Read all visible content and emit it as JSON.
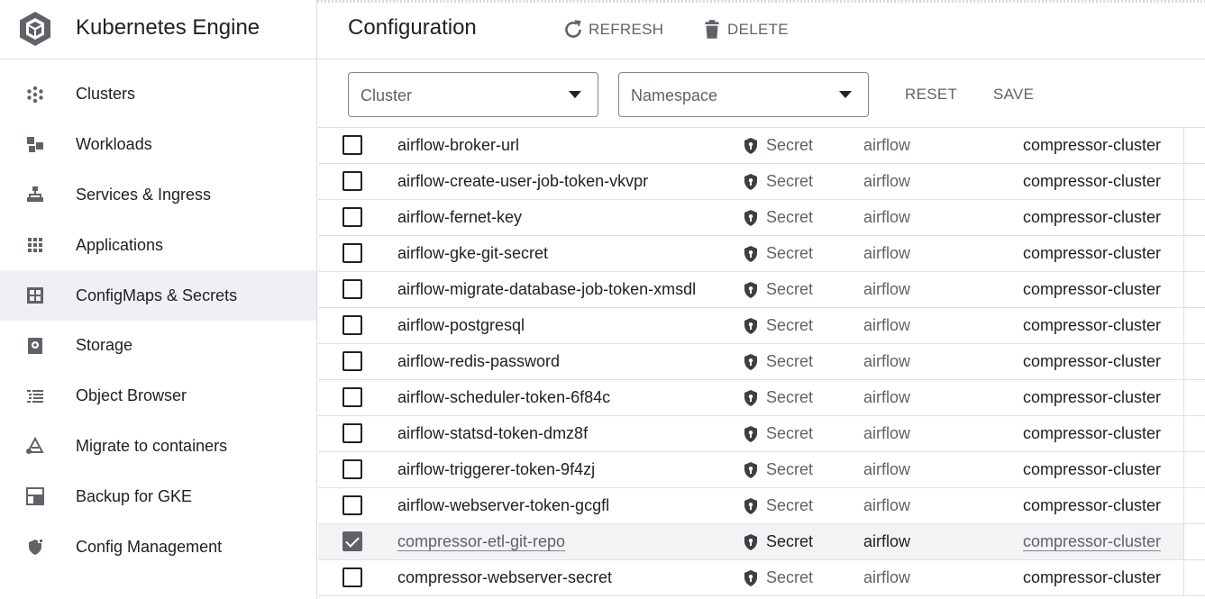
{
  "app": {
    "title": "Kubernetes Engine",
    "logo_icon": "kubernetes-engine-icon"
  },
  "sidebar": {
    "items": [
      {
        "label": "Clusters",
        "icon": "clusters-icon",
        "active": false
      },
      {
        "label": "Workloads",
        "icon": "workloads-icon",
        "active": false
      },
      {
        "label": "Services & Ingress",
        "icon": "services-icon",
        "active": false
      },
      {
        "label": "Applications",
        "icon": "applications-icon",
        "active": false
      },
      {
        "label": "ConfigMaps & Secrets",
        "icon": "configmaps-icon",
        "active": true
      },
      {
        "label": "Storage",
        "icon": "storage-icon",
        "active": false
      },
      {
        "label": "Object Browser",
        "icon": "object-browser-icon",
        "active": false
      },
      {
        "label": "Migrate to containers",
        "icon": "migrate-icon",
        "active": false
      },
      {
        "label": "Backup for GKE",
        "icon": "backup-icon",
        "active": false
      },
      {
        "label": "Config Management",
        "icon": "config-management-icon",
        "active": false
      }
    ]
  },
  "header": {
    "title": "Configuration",
    "refresh_label": "REFRESH",
    "delete_label": "DELETE"
  },
  "filters": {
    "cluster_placeholder": "Cluster",
    "namespace_placeholder": "Namespace",
    "reset_label": "RESET",
    "save_label": "SAVE"
  },
  "table": {
    "rows": [
      {
        "name": "airflow-broker-url",
        "type": "Secret",
        "namespace": "airflow",
        "cluster": "compressor-cluster",
        "checked": false
      },
      {
        "name": "airflow-create-user-job-token-vkvpr",
        "type": "Secret",
        "namespace": "airflow",
        "cluster": "compressor-cluster",
        "checked": false
      },
      {
        "name": "airflow-fernet-key",
        "type": "Secret",
        "namespace": "airflow",
        "cluster": "compressor-cluster",
        "checked": false
      },
      {
        "name": "airflow-gke-git-secret",
        "type": "Secret",
        "namespace": "airflow",
        "cluster": "compressor-cluster",
        "checked": false
      },
      {
        "name": "airflow-migrate-database-job-token-xmsdl",
        "type": "Secret",
        "namespace": "airflow",
        "cluster": "compressor-cluster",
        "checked": false
      },
      {
        "name": "airflow-postgresql",
        "type": "Secret",
        "namespace": "airflow",
        "cluster": "compressor-cluster",
        "checked": false
      },
      {
        "name": "airflow-redis-password",
        "type": "Secret",
        "namespace": "airflow",
        "cluster": "compressor-cluster",
        "checked": false
      },
      {
        "name": "airflow-scheduler-token-6f84c",
        "type": "Secret",
        "namespace": "airflow",
        "cluster": "compressor-cluster",
        "checked": false
      },
      {
        "name": "airflow-statsd-token-dmz8f",
        "type": "Secret",
        "namespace": "airflow",
        "cluster": "compressor-cluster",
        "checked": false
      },
      {
        "name": "airflow-triggerer-token-9f4zj",
        "type": "Secret",
        "namespace": "airflow",
        "cluster": "compressor-cluster",
        "checked": false
      },
      {
        "name": "airflow-webserver-token-gcgfl",
        "type": "Secret",
        "namespace": "airflow",
        "cluster": "compressor-cluster",
        "checked": false
      },
      {
        "name": "compressor-etl-git-repo",
        "type": "Secret",
        "namespace": "airflow",
        "cluster": "compressor-cluster",
        "checked": true
      },
      {
        "name": "compressor-webserver-secret",
        "type": "Secret",
        "namespace": "airflow",
        "cluster": "compressor-cluster",
        "checked": false
      }
    ]
  }
}
